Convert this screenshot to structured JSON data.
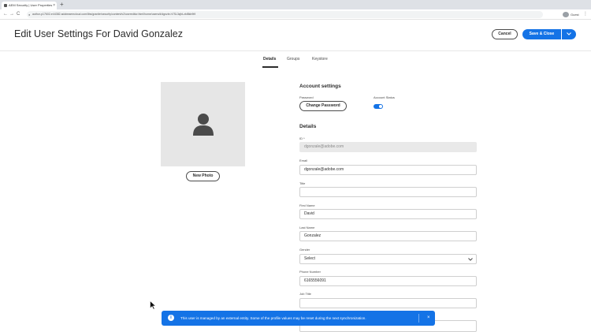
{
  "browser": {
    "tab_title": "AEM Security | User Properties",
    "tab_close": "×",
    "new_tab": "+",
    "url": "author-p17602-e44382.adobeaemcloud.com/libs/granite/security/content/v2/usereditor.html/home/users/d/dgnzle-h7SL3zjbLzkt5kb9t9",
    "profile_label": "Guest",
    "back": "←",
    "forward": "→",
    "reload": "C",
    "menu": "⋮"
  },
  "header": {
    "title": "Edit User Settings For David Gonzalez",
    "cancel_label": "Cancel",
    "save_label": "Save & Close",
    "save_menu_icon": "chevron-down-icon"
  },
  "tabs": [
    {
      "label": "Details",
      "active": true
    },
    {
      "label": "Groups",
      "active": false
    },
    {
      "label": "Keystore",
      "active": false
    }
  ],
  "photo": {
    "button_label": "New Photo",
    "icon": "user-icon"
  },
  "account_settings": {
    "heading": "Account settings",
    "password_label": "Password",
    "change_password_label": "Change Password",
    "status_label": "Account Status",
    "status_enabled": true
  },
  "details": {
    "heading": "Details",
    "id_label": "ID *",
    "id_value": "dgonzale@adobe.com",
    "email_label": "Email",
    "email_value": "dgonzale@adobe.com",
    "title_label": "Title",
    "title_value": "",
    "first_name_label": "First Name",
    "first_name_value": "David",
    "last_name_label": "Last Name",
    "last_name_value": "Gonzalez",
    "gender_label": "Gender",
    "gender_value": "Select",
    "phone_label": "Phone Number",
    "phone_value": "6165556091",
    "job_title_label": "Job Title",
    "job_title_value": ""
  },
  "toast": {
    "message": "This user is managed by an external entity. Some of the profile values may be reset during the next synchronization.",
    "icon": "info-icon",
    "close": "×"
  },
  "colors": {
    "accent": "#1473e6",
    "text": "#2c2c2c",
    "disabled_field": "#e9e9e9"
  }
}
